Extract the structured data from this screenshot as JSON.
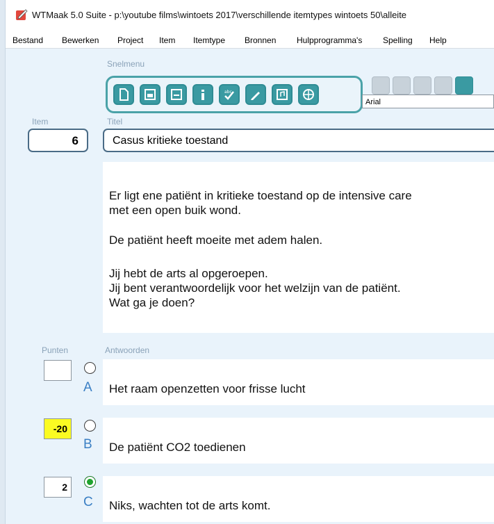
{
  "window": {
    "title": "WTMaak 5.0 Suite - p:\\youtube films\\wintoets 2017\\verschillende itemtypes wintoets 50\\alleite"
  },
  "menu": [
    {
      "label": "Bestand"
    },
    {
      "label": "Bewerken"
    },
    {
      "label": "Project"
    },
    {
      "label": "Item"
    },
    {
      "label": "Itemtype"
    },
    {
      "label": "Bronnen"
    },
    {
      "label": "Hulpprogramma's"
    },
    {
      "label": "Spelling"
    },
    {
      "label": "Help"
    }
  ],
  "snelmenu": {
    "label": "Snelmenu",
    "buttons": [
      {
        "icon": "new-document-icon"
      },
      {
        "icon": "open-icon"
      },
      {
        "icon": "save-icon"
      },
      {
        "icon": "info-icon"
      },
      {
        "icon": "spellcheck-icon"
      },
      {
        "icon": "edit-pen-icon"
      },
      {
        "icon": "media-icon"
      },
      {
        "icon": "globe-icon"
      }
    ]
  },
  "format_toolbar": {
    "buttons": [
      {
        "icon": "format-icon-1"
      },
      {
        "icon": "format-icon-2"
      },
      {
        "icon": "format-icon-3"
      },
      {
        "icon": "format-icon-4"
      },
      {
        "icon": "format-icon-5"
      }
    ],
    "font": "Arial"
  },
  "item": {
    "label": "Item",
    "number": "6"
  },
  "titel": {
    "label": "Titel",
    "value": "Casus kritieke toestand"
  },
  "question": {
    "lines": [
      "Er ligt ene patiënt in kritieke toestand op de intensive care",
      "met een open buik wond.",
      "De patiënt heeft moeite met adem halen.",
      "Jij hebt de arts al opgeroepen.",
      "Jij bent verantwoordelijk voor het welzijn van de patiënt.",
      "Wat ga je doen?"
    ]
  },
  "answers_section": {
    "points_label": "Punten",
    "answers_label": "Antwoorden"
  },
  "answers": [
    {
      "letter": "A",
      "points": "",
      "text": "Het raam openzetten voor frisse lucht",
      "selected": false
    },
    {
      "letter": "B",
      "points": "-20",
      "text": "De patiënt CO2 toedienen",
      "selected": false
    },
    {
      "letter": "C",
      "points": "2",
      "text": "Niks, wachten tot de arts komt.",
      "selected": true
    }
  ],
  "colors": {
    "accent": "#3a9aa2",
    "negative_points_bg": "#fbfb22",
    "selected_radio": "#1fa32e",
    "letter": "#3a7fc4"
  }
}
